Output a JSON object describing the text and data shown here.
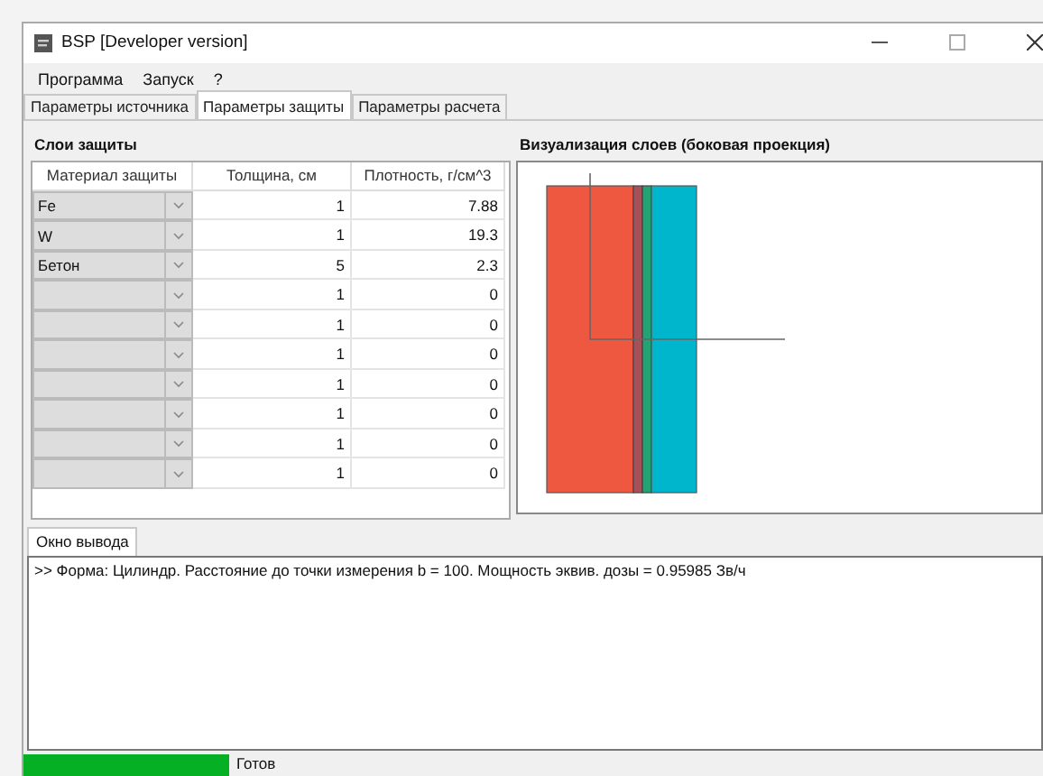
{
  "window": {
    "title": "BSP [Developer version]"
  },
  "menu": [
    "Программа",
    "Запуск",
    "?"
  ],
  "tabs": [
    {
      "label": "Параметры источника",
      "selected": false
    },
    {
      "label": "Параметры защиты",
      "selected": true
    },
    {
      "label": "Параметры расчета",
      "selected": false
    }
  ],
  "layers_panel": {
    "title": "Слои защиты",
    "columns": [
      "Материал защиты",
      "Толщина, см",
      "Плотность, г/см^3"
    ],
    "rows": [
      {
        "material": "Fe",
        "thickness": "1",
        "density": "7.88"
      },
      {
        "material": "W",
        "thickness": "1",
        "density": "19.3"
      },
      {
        "material": "Бетон",
        "thickness": "5",
        "density": "2.3"
      },
      {
        "thickness": "1",
        "density": "0"
      },
      {
        "thickness": "1",
        "density": "0"
      },
      {
        "thickness": "1",
        "density": "0"
      },
      {
        "thickness": "1",
        "density": "0"
      },
      {
        "thickness": "1",
        "density": "0"
      },
      {
        "thickness": "1",
        "density": "0"
      },
      {
        "thickness": "1",
        "density": "0"
      }
    ]
  },
  "visualization": {
    "title": "Визуализация слоев (боковая проекция)"
  },
  "output": {
    "tab": "Окно вывода",
    "lines": [
      ">> Форма: Цилиндр. Расстояние до точки измерения b = 100. Мощность эквив. дозы = 0.95985 Зв/ч"
    ]
  },
  "status_bar": {
    "level": 1,
    "text": "Готов"
  }
}
